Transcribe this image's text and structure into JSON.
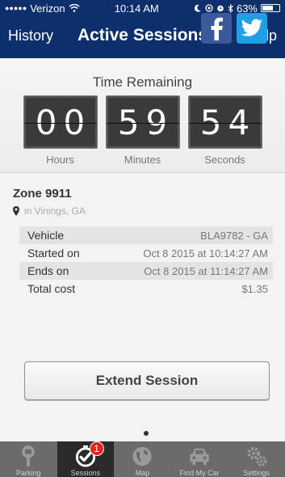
{
  "status_bar": {
    "carrier": "Verizon",
    "time": "10:14 AM",
    "battery": "63%",
    "battery_level": 0.63
  },
  "nav": {
    "history_label": "History",
    "title": "Active Sessions",
    "help_label": "Help"
  },
  "timer": {
    "label": "Time Remaining",
    "hours": "00",
    "minutes": "59",
    "seconds": "54",
    "hours_label": "Hours",
    "minutes_label": "Minutes",
    "seconds_label": "Seconds"
  },
  "zone": {
    "name": "Zone 9911",
    "location": "in Vinings, GA"
  },
  "details": [
    {
      "key": "Vehicle",
      "value": "BLA9782 - GA"
    },
    {
      "key": "Started on",
      "value": "Oct 8 2015 at 10:14:27 AM"
    },
    {
      "key": "Ends on",
      "value": "Oct 8 2015 at 11:14:27 AM"
    },
    {
      "key": "Total cost",
      "value": "$1.35"
    }
  ],
  "extend_label": "Extend Session",
  "colors": {
    "nav_bg": "#0d2f6b",
    "facebook": "#3b5898",
    "twitter": "#1fa0e6",
    "badge": "#e52222"
  },
  "tabs": [
    {
      "label": "Parking",
      "icon": "parking-meter-icon"
    },
    {
      "label": "Sessions",
      "icon": "timer-check-icon",
      "badge": "1"
    },
    {
      "label": "Map",
      "icon": "globe-icon"
    },
    {
      "label": "Find My Car",
      "icon": "car-icon"
    },
    {
      "label": "Settings",
      "icon": "gears-icon"
    }
  ]
}
